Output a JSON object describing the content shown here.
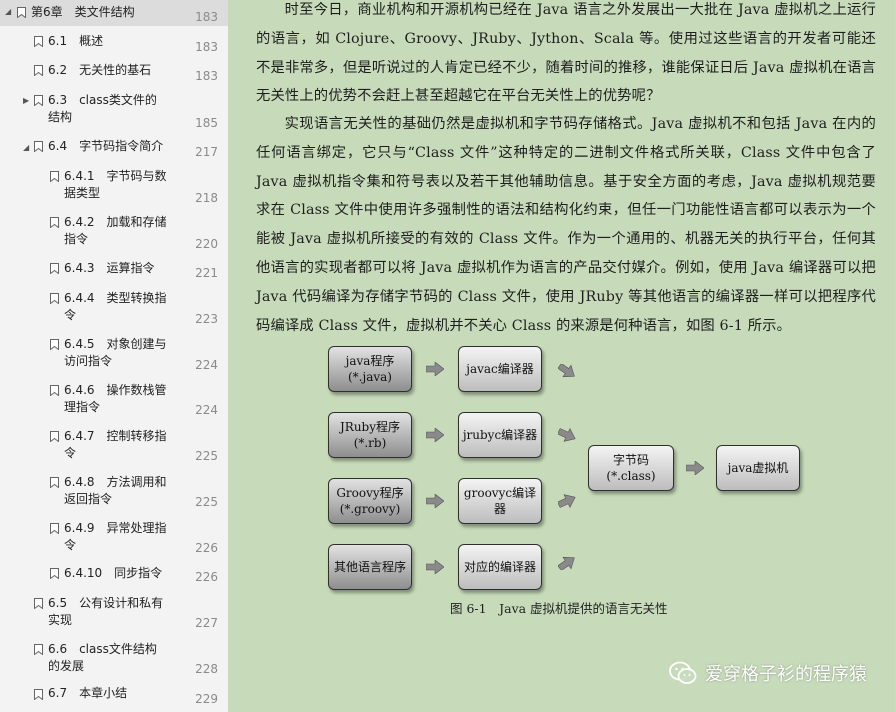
{
  "toc": {
    "items": [
      {
        "label": "第6章　类文件结构",
        "page": "183"
      },
      {
        "label": "6.1　概述",
        "page": "183"
      },
      {
        "label": "6.2　无关性的基石",
        "page": "183"
      },
      {
        "label": "6.3　class类文件的",
        "label2": "结构",
        "page": "185"
      },
      {
        "label": "6.4　字节码指令简介",
        "page": "217"
      },
      {
        "label": "6.4.1　字节码与数",
        "label2": "据类型",
        "page": "218"
      },
      {
        "label": "6.4.2　加载和存储",
        "label2": "指令",
        "page": "220"
      },
      {
        "label": "6.4.3　运算指令",
        "page": "221"
      },
      {
        "label": "6.4.4　类型转换指",
        "label2": "令",
        "page": "223"
      },
      {
        "label": "6.4.5　对象创建与",
        "label2": "访问指令",
        "page": "224"
      },
      {
        "label": "6.4.6　操作数栈管",
        "label2": "理指令",
        "page": "224"
      },
      {
        "label": "6.4.7　控制转移指",
        "label2": "令",
        "page": "225"
      },
      {
        "label": "6.4.8　方法调用和",
        "label2": "返回指令",
        "page": "225"
      },
      {
        "label": "6.4.9　异常处理指",
        "label2": "令",
        "page": "226"
      },
      {
        "label": "6.4.10　同步指令",
        "page": "226"
      },
      {
        "label": "6.5　公有设计和私有",
        "label2": "实现",
        "page": "227"
      },
      {
        "label": "6.6　class文件结构",
        "label2": "的发展",
        "page": "228"
      },
      {
        "label": "6.7　本章小结",
        "page": "229"
      }
    ]
  },
  "content": {
    "para1": "时至今日，商业机构和开源机构已经在 Java 语言之外发展出一大批在 Java 虚拟机之上运行的语言，如 Clojure、Groovy、JRuby、Jython、Scala 等。使用过这些语言的开发者可能还不是非常多，但是听说过的人肯定已经不少，随着时间的推移，谁能保证日后 Java 虚拟机在语言无关性上的优势不会赶上甚至超越它在平台无关性上的优势呢？",
    "para2": "实现语言无关性的基础仍然是虚拟机和字节码存储格式。Java 虚拟机不和包括 Java 在内的任何语言绑定，它只与“Class 文件”这种特定的二进制文件格式所关联，Class 文件中包含了 Java 虚拟机指令集和符号表以及若干其他辅助信息。基于安全方面的考虑，Java 虚拟机规范要求在 Class 文件中使用许多强制性的语法和结构化约束，但任一门功能性语言都可以表示为一个能被 Java 虚拟机所接受的有效的 Class 文件。作为一个通用的、机器无关的执行平台，任何其他语言的实现者都可以将 Java 虚拟机作为语言的产品交付媒介。例如，使用 Java 编译器可以把 Java 代码编译为存储字节码的 Class 文件，使用 JRuby 等其他语言的编译器一样可以把程序代码编译成 Class 文件，虚拟机并不关心 Class 的来源是何种语言，如图 6-1 所示。"
  },
  "figure": {
    "sources": [
      {
        "line1": "java程序",
        "line2": "(*.java)"
      },
      {
        "line1": "JRuby程序",
        "line2": "(*.rb)"
      },
      {
        "line1": "Groovy程序",
        "line2": "(*.groovy)"
      },
      {
        "line1": "其他语言程序",
        "line2": ""
      }
    ],
    "compilers": [
      "javac编译器",
      "jrubyc编译器",
      "groovyc编译器",
      "对应的编译器"
    ],
    "bytecode": {
      "line1": "字节码",
      "line2": "(*.class)"
    },
    "jvm": "java虚拟机",
    "caption": "图 6-1　Java 虚拟机提供的语言无关性"
  },
  "watermark": {
    "text": "爱穿格子衫的程序猿",
    "icon": "wechat-icon"
  }
}
